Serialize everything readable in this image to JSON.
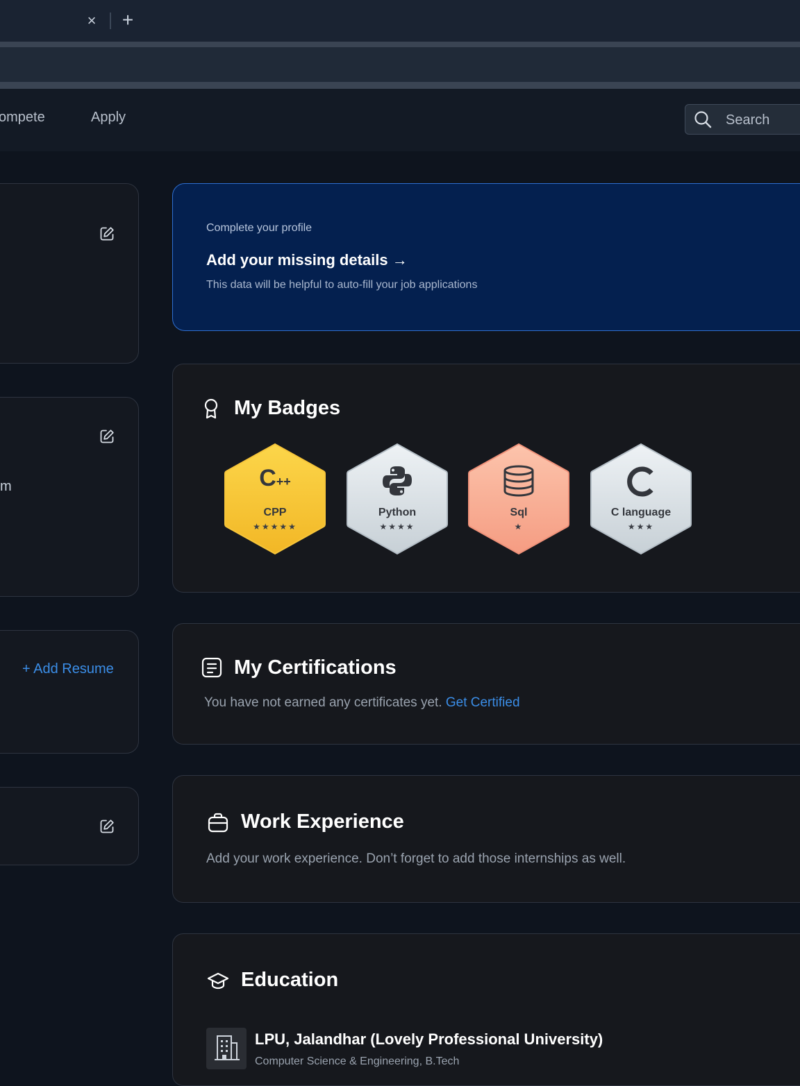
{
  "browser": {
    "tab_close": "×",
    "tab_new": "+"
  },
  "nav": {
    "items": [
      "ompete",
      "Apply"
    ],
    "search_placeholder": "Search"
  },
  "left": {
    "partial_text": "m",
    "add_resume": "+ Add Resume"
  },
  "profile_prompt": {
    "eyebrow": "Complete your profile",
    "title": "Add your missing details →",
    "description": "This data will be helpful to auto-fill your job applications"
  },
  "badges": {
    "title": "My Badges",
    "items": [
      {
        "name": "CPP",
        "glyph": "C++",
        "stars": "★★★★★",
        "stars_count": 5,
        "color_top": "#fcd64a",
        "color_bottom": "#f2b726"
      },
      {
        "name": "Python",
        "glyph": "python-logo",
        "stars": "★★★★",
        "stars_count": 4,
        "color_top": "#eef2f5",
        "color_bottom": "#c7d0d6"
      },
      {
        "name": "Sql",
        "glyph": "database-icon",
        "stars": "★",
        "stars_count": 1,
        "color_top": "#fcc4ac",
        "color_bottom": "#f59c82"
      },
      {
        "name": "C language",
        "glyph": "C",
        "stars": "★★★",
        "stars_count": 3,
        "color_top": "#eef2f5",
        "color_bottom": "#c7d0d6"
      }
    ]
  },
  "certifications": {
    "title": "My Certifications",
    "text": "You have not earned any certificates yet.",
    "link": "Get Certified"
  },
  "work": {
    "title": "Work Experience",
    "text": "Add your work experience. Don’t forget to add those internships as well."
  },
  "education": {
    "title": "Education",
    "school": "LPU, Jalandhar (Lovely Professional University)",
    "degree": "Computer Science & Engineering, B.Tech"
  },
  "colors": {
    "accent": "#3b8ee8",
    "profile_card_bg": "#04204f",
    "page_bg": "#0e141e"
  }
}
